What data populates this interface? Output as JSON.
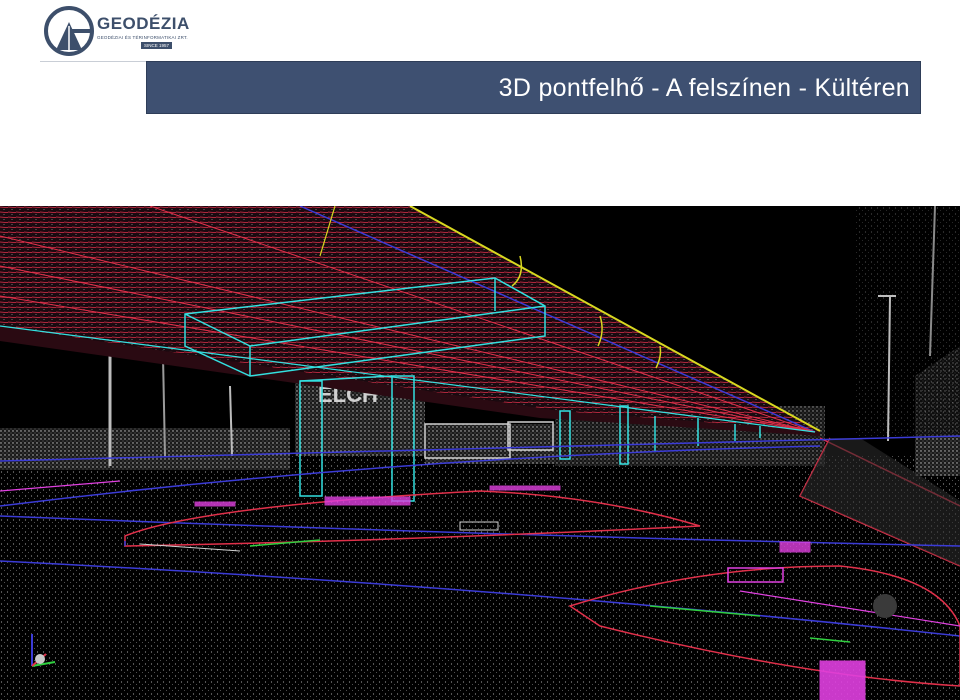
{
  "logo": {
    "name": "GEODÉZIA",
    "tagline": "GEODÉZIAI ÉS TÉRINFORMATIKAI ZRT.",
    "since": "SINCE 1957"
  },
  "slide": {
    "title": "3D pontfelhő -  A felszínen - Kültéren"
  },
  "image": {
    "label_sign": "ELCH",
    "colors": {
      "background": "#000000",
      "bridge_lines": "#e0304a",
      "outline": "#33e0e0",
      "road_lines": "#3b3bd6",
      "markings": "#e040e0",
      "guide": "#d8d820"
    }
  }
}
